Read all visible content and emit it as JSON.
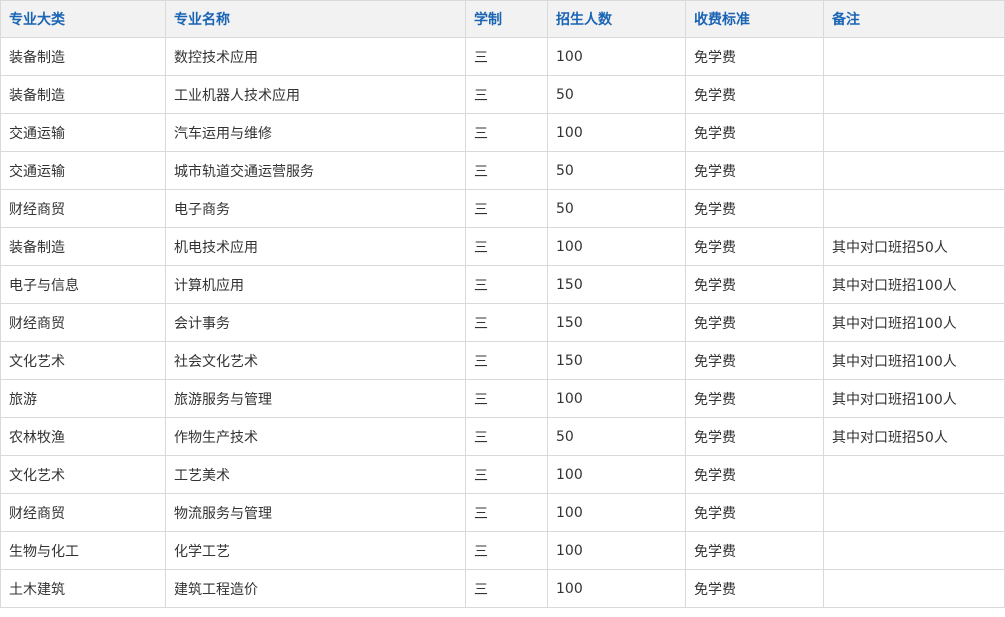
{
  "table": {
    "headers": [
      "专业大类",
      "专业名称",
      "学制",
      "招生人数",
      "收费标准",
      "备注"
    ],
    "rows": [
      [
        "装备制造",
        "数控技术应用",
        "三",
        "100",
        "免学费",
        ""
      ],
      [
        "装备制造",
        "工业机器人技术应用",
        "三",
        "50",
        "免学费",
        ""
      ],
      [
        "交通运输",
        "汽车运用与维修",
        "三",
        "100",
        "免学费",
        ""
      ],
      [
        "交通运输",
        "城市轨道交通运营服务",
        "三",
        "50",
        "免学费",
        ""
      ],
      [
        "财经商贸",
        "电子商务",
        "三",
        "50",
        "免学费",
        ""
      ],
      [
        "装备制造",
        "机电技术应用",
        "三",
        "100",
        "免学费",
        "其中对口班招50人"
      ],
      [
        "电子与信息",
        "计算机应用",
        "三",
        "150",
        "免学费",
        "其中对口班招100人"
      ],
      [
        "财经商贸",
        "会计事务",
        "三",
        "150",
        "免学费",
        "其中对口班招100人"
      ],
      [
        "文化艺术",
        "社会文化艺术",
        "三",
        "150",
        "免学费",
        "其中对口班招100人"
      ],
      [
        "旅游",
        "旅游服务与管理",
        "三",
        "100",
        "免学费",
        "其中对口班招100人"
      ],
      [
        "农林牧渔",
        "作物生产技术",
        "三",
        "50",
        "免学费",
        "其中对口班招50人"
      ],
      [
        "文化艺术",
        "工艺美术",
        "三",
        "100",
        "免学费",
        ""
      ],
      [
        "财经商贸",
        "物流服务与管理",
        "三",
        "100",
        "免学费",
        ""
      ],
      [
        "生物与化工",
        "化学工艺",
        "三",
        "100",
        "免学费",
        ""
      ],
      [
        "土木建筑",
        "建筑工程造价",
        "三",
        "100",
        "免学费",
        ""
      ]
    ]
  },
  "colors": {
    "header_text": "#1a64b4",
    "header_bg": "#f2f2f2",
    "border": "#d9d9d9",
    "cell_text": "#333333"
  }
}
